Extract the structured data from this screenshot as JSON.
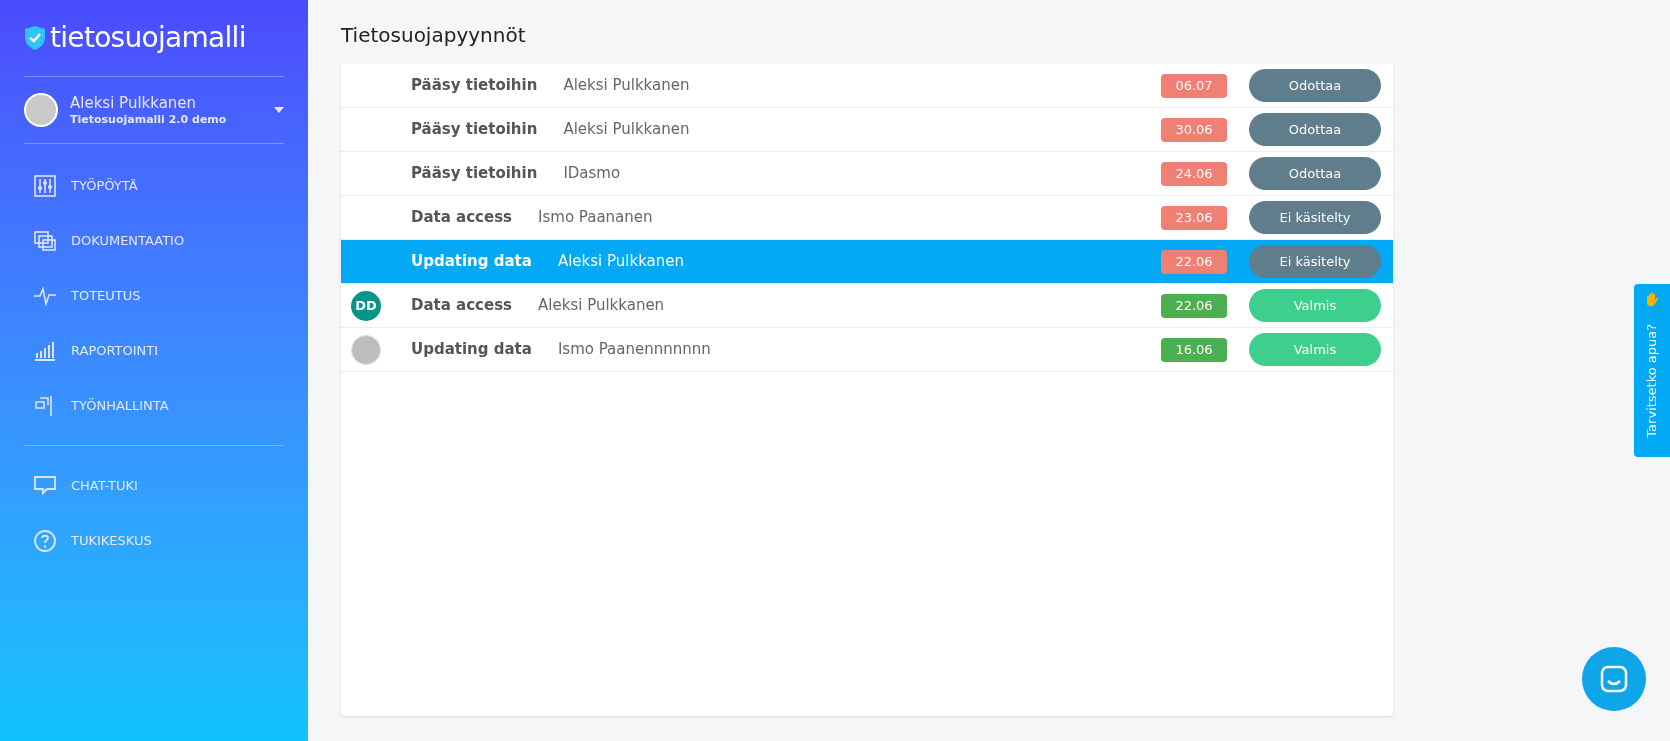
{
  "sidebar": {
    "logo": "tietosuojamalli",
    "user": {
      "name": "Aleksi Pulkkanen",
      "subtitle": "Tietosuojamalli 2.0 demo"
    },
    "nav": [
      {
        "label": "TYÖPÖYTÄ"
      },
      {
        "label": "DOKUMENTAATIO"
      },
      {
        "label": "TOTEUTUS"
      },
      {
        "label": "RAPORTOINTI"
      },
      {
        "label": "TYÖNHALLINTA"
      }
    ],
    "support": [
      {
        "label": "CHAT-TUKI"
      },
      {
        "label": "TUKIKESKUS"
      }
    ]
  },
  "page_title": "Tietosuojapyynnöt",
  "requests": [
    {
      "kind": "plain",
      "type": "Pääsy tietoihin",
      "person": "Aleksi Pulkkanen",
      "date": "06.07",
      "color": "#f07f74",
      "status": "Odottaa",
      "done": false,
      "selected": false
    },
    {
      "kind": "plain",
      "type": "Pääsy tietoihin",
      "person": "Aleksi Pulkkanen",
      "date": "30.06",
      "color": "#f07f74",
      "status": "Odottaa",
      "done": false,
      "selected": false
    },
    {
      "kind": "plain",
      "type": "Pääsy tietoihin",
      "person": "IDasmo",
      "date": "24.06",
      "color": "#f07f74",
      "status": "Odottaa",
      "done": false,
      "selected": false
    },
    {
      "kind": "plain",
      "type": "Data access",
      "person": "Ismo Paananen",
      "date": "23.06",
      "color": "#f07f74",
      "status": "Ei käsitelty",
      "done": false,
      "selected": false
    },
    {
      "kind": "plain",
      "type": "Updating data",
      "person": "Aleksi Pulkkanen",
      "date": "22.06",
      "color": "#f07f74",
      "status": "Ei käsitelty",
      "done": false,
      "selected": true
    },
    {
      "kind": "initials",
      "initials": "DD",
      "type": "Data access",
      "person": "Aleksi Pulkkanen",
      "date": "22.06",
      "color": "#4caf50",
      "status": "Valmis",
      "done": true,
      "selected": false
    },
    {
      "kind": "photo",
      "type": "Updating data",
      "person": "Ismo Paanennnnnnn",
      "date": "16.06",
      "color": "#4caf50",
      "status": "Valmis",
      "done": true,
      "selected": false
    }
  ],
  "help_tab": {
    "label": "Tarvitsetko apua?"
  }
}
